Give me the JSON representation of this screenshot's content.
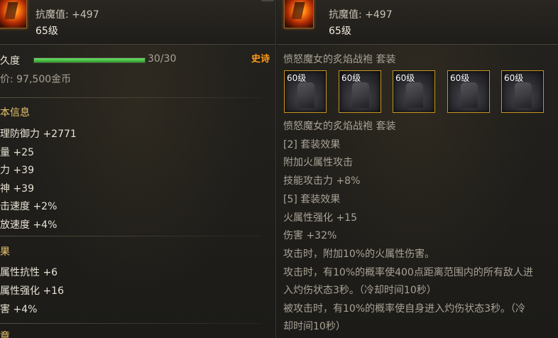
{
  "left": {
    "header": {
      "magic_resist": "抗魔值: +497",
      "level": "65级"
    },
    "durability": {
      "label": "久度",
      "value": "30/30",
      "fraction": 1.0
    },
    "rarity": "史诗",
    "price": "价: 97,500金币",
    "basic_info": {
      "title": "本信息",
      "lines": [
        "理防御力 +2771",
        "量 +25",
        "力 +39",
        "神 +39",
        "击速度 +2%",
        "放速度 +4%"
      ]
    },
    "effects": {
      "title": "果",
      "lines": [
        "属性抗性 +6",
        "属性强化 +16",
        "害 +4%"
      ]
    },
    "next_title": "章"
  },
  "right": {
    "header": {
      "magic_resist": "抗魔值: +497",
      "level": "65级"
    },
    "set_name": "愤怒魔女的炙焰战袍 套装",
    "set_slots": [
      "60级",
      "60级",
      "60级",
      "60级",
      "60级"
    ],
    "set_name_2": "愤怒魔女的炙焰战袍 套装",
    "lines": [
      "[2] 套装效果",
      "附加火属性攻击",
      "技能攻击力 +8%",
      "[5] 套装效果",
      "火属性强化 +15",
      "伤害 +32%",
      "攻击时，附加10%的火属性伤害。",
      "攻击时，有10%的概率使400点距离范围内的所有敌人进",
      "入灼伤状态3秒。（冷却时间10秒）",
      "被攻击时，有10%的概率使自身进入灼伤状态3秒。（冷",
      "却时间10秒）"
    ]
  },
  "colors": {
    "section_title": "#e9c46a",
    "epic": "#ff9a1a",
    "slot_border": "#c8951f",
    "durability_fill": "#4fc14a"
  }
}
